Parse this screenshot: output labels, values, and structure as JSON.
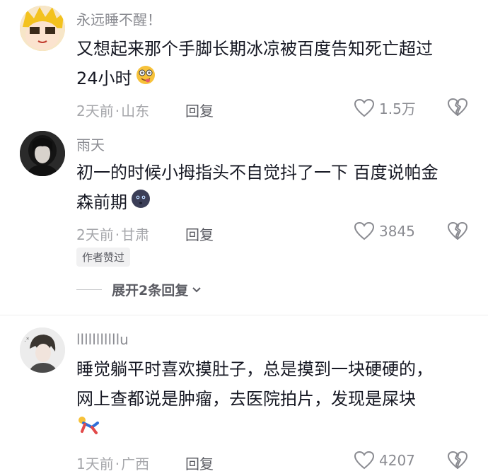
{
  "comments": [
    {
      "username": "永远睡不醒！",
      "text_line1": "又想起来那个手脚长期冰凉被百度告知死亡超过",
      "text_line2": "24小时",
      "emoji": "dizzy-tongue-emoji",
      "time": "2天前",
      "location": "山东",
      "reply_label": "回复",
      "likes": "1.5万"
    },
    {
      "username": "雨天",
      "text_line1": "初一的时候小拇指头不自觉抖了一下 百度说帕金",
      "text_line2": "森前期",
      "emoji": "dark-face-emoji",
      "time": "2天前",
      "location": "甘肃",
      "reply_label": "回复",
      "likes": "3845",
      "author_badge": "作者赞过",
      "expand_label": "展开2条回复"
    },
    {
      "username": "lllllllllllu",
      "text_line1": "睡觉躺平时喜欢摸肚子，总是摸到一块硬硬的，",
      "text_line2": "网上查都说是肿瘤，去医院拍片，发现是屎块",
      "emoji": "falling-person-emoji",
      "time": "1天前",
      "location": "广西",
      "reply_label": "回复",
      "likes": "4207"
    }
  ],
  "separator": "·",
  "colors": {
    "text": "#161823",
    "username": "#8a8b91",
    "meta": "#a6a7ab",
    "reply": "#5b5c63"
  }
}
